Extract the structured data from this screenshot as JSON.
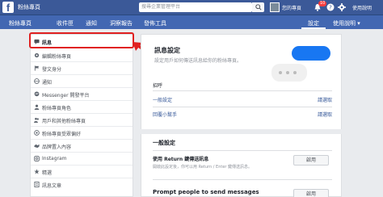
{
  "topbar": {
    "logo": "f",
    "page_name": "粉絲專頁",
    "search_placeholder": "搜尋企業管理平台",
    "user_name": "您的專頁",
    "notif_count": "10",
    "help_label": "使用說明"
  },
  "nav": {
    "items": [
      "粉絲專頁",
      "收件匣",
      "通知",
      "洞察報告",
      "發佈工具"
    ],
    "settings": "設定",
    "help": "使用說明 ▾"
  },
  "sidebar": {
    "items": [
      {
        "label": "訊息",
        "icon": "message-icon"
      },
      {
        "label": "編輯粉絲專頁",
        "icon": "gear-icon"
      },
      {
        "label": "發文身分",
        "icon": "flag-icon"
      },
      {
        "label": "通知",
        "icon": "globe-icon"
      },
      {
        "label": "Messenger 開發平台",
        "icon": "messenger-icon"
      },
      {
        "label": "粉絲專頁角色",
        "icon": "person-icon"
      },
      {
        "label": "用戶和其他粉絲專頁",
        "icon": "people-icon"
      },
      {
        "label": "粉絲專頁受眾偏好",
        "icon": "target-icon"
      },
      {
        "label": "品牌置入內容",
        "icon": "handshake-icon"
      },
      {
        "label": "Instagram",
        "icon": "instagram-icon"
      },
      {
        "label": "精選",
        "icon": "star-icon"
      },
      {
        "label": "訊息文章",
        "icon": "article-icon"
      }
    ]
  },
  "main": {
    "messaging_title": "訊息設定",
    "messaging_desc": "設定用戶如何傳送訊息給你的粉絲專頁。",
    "greeting_header": "招呼",
    "rows": [
      {
        "label": "一般設定",
        "link": "請選取"
      },
      {
        "label": "回覆小幫手",
        "link": "請選取"
      }
    ],
    "section_title": "一般設定",
    "option_title": "使用 Return 鍵傳送訊息",
    "option_desc": "開啟此設定後，你可以用 Return / Enter 鍵傳送訊息。",
    "option_button": "啟用",
    "option2_title": "Prompt people to send messages",
    "option2_button": "啟用"
  },
  "colors": {
    "topbar": "#3b5998",
    "navbar": "#4267b2",
    "toggle": "#1877f2",
    "highlight": "#e02020"
  }
}
